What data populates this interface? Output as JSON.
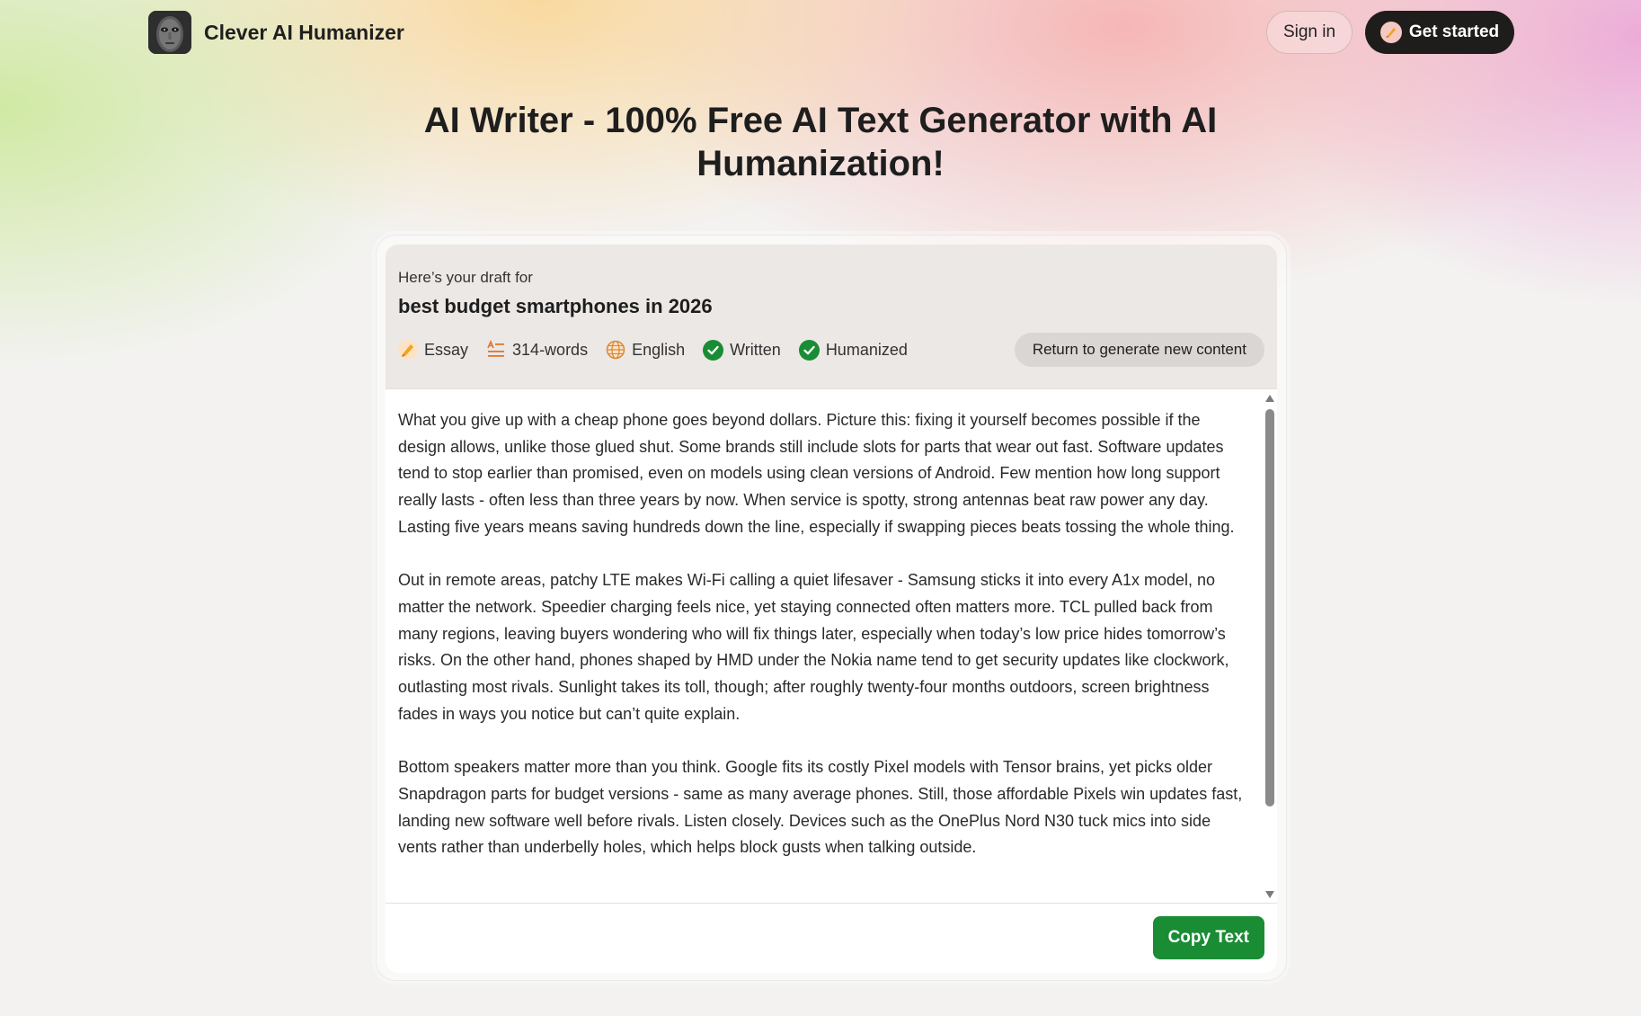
{
  "header": {
    "brand_name": "Clever AI Humanizer",
    "sign_in_label": "Sign in",
    "get_started_label": "Get started"
  },
  "page": {
    "title": "AI Writer - 100% Free AI Text Generator with AI Humanization!"
  },
  "draft": {
    "intro": "Here’s your draft for",
    "topic": "best budget smartphones in 2026",
    "meta": [
      {
        "icon": "pencil-emoji-icon",
        "label": "Essay"
      },
      {
        "icon": "text-lines-icon",
        "label": "314-words"
      },
      {
        "icon": "globe-icon",
        "label": "English"
      },
      {
        "icon": "check-circle-icon",
        "label": "Written"
      },
      {
        "icon": "check-circle-icon",
        "label": "Humanized"
      }
    ],
    "return_label": "Return to generate new content",
    "paragraphs": [
      "What you give up with a cheap phone goes beyond dollars. Picture this: fixing it yourself becomes possible if the design allows, unlike those glued shut. Some brands still include slots for parts that wear out fast. Software updates tend to stop earlier than promised, even on models using clean versions of Android. Few mention how long support really lasts - often less than three years by now. When service is spotty, strong antennas beat raw power any day. Lasting five years means saving hundreds down the line, especially if swapping pieces beats tossing the whole thing.",
      "Out in remote areas, patchy LTE makes Wi-Fi calling a quiet lifesaver - Samsung sticks it into every A1x model, no matter the network. Speedier charging feels nice, yet staying connected often matters more. TCL pulled back from many regions, leaving buyers wondering who will fix things later, especially when today’s low price hides tomorrow’s risks. On the other hand, phones shaped by HMD under the Nokia name tend to get security updates like clockwork, outlasting most rivals. Sunlight takes its toll, though; after roughly twenty-four months outdoors, screen brightness fades in ways you notice but can’t quite explain.",
      "Bottom speakers matter more than you think. Google fits its costly Pixel models with Tensor brains, yet picks older Snapdragon parts for budget versions - same as many average phones. Still, those affordable Pixels win updates fast, landing new software well before rivals. Listen closely. Devices such as the OnePlus Nord N30 tuck mics into side vents rather than underbelly holes, which helps block gusts when talking outside."
    ],
    "copy_label": "Copy Text"
  },
  "colors": {
    "check_green": "#1a8c34",
    "dark_button": "#1f1c1c",
    "copy_button": "#1a8c34"
  }
}
